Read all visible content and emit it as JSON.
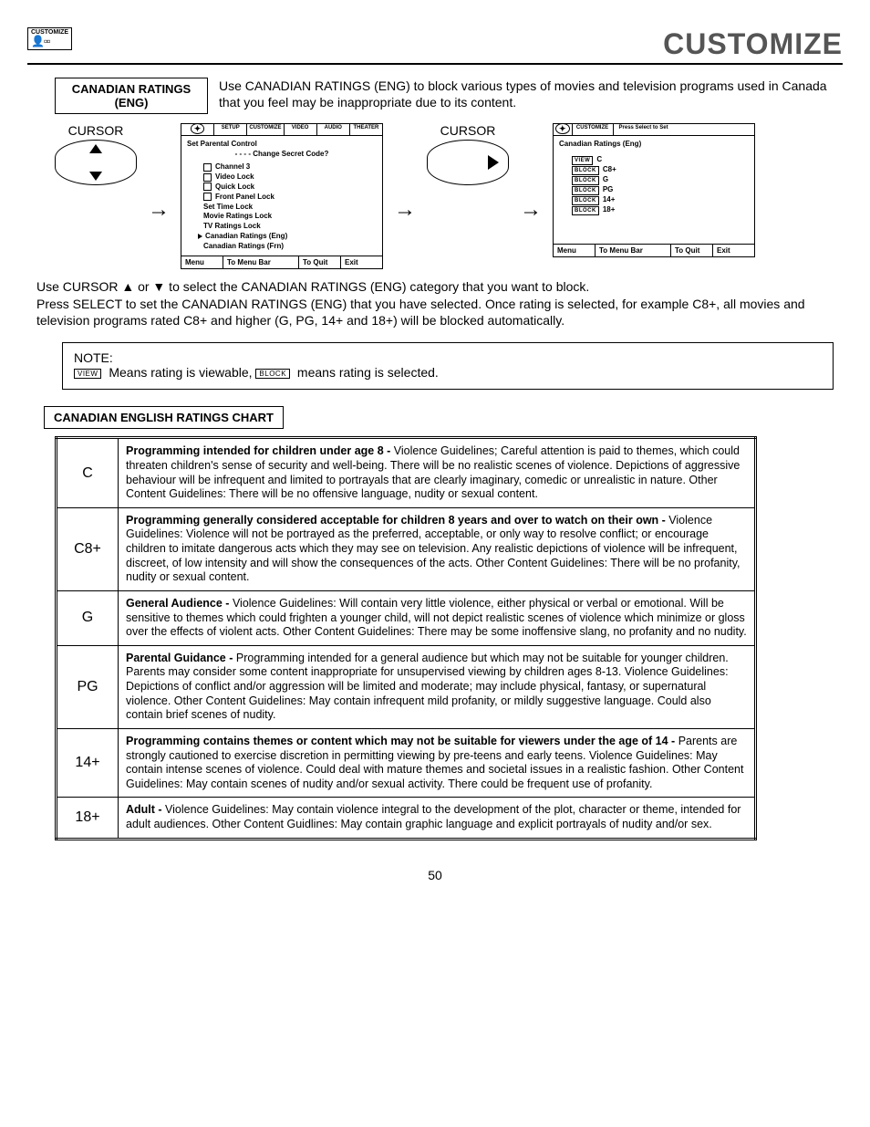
{
  "header": {
    "logo_label": "CUSTOMIZE",
    "title": "CUSTOMIZE"
  },
  "section_box": {
    "line1": "CANADIAN RATINGS",
    "line2": "(ENG)"
  },
  "intro": "Use CANADIAN RATINGS (ENG) to block various types of movies and television programs used in Canada that you feel may be inappropriate due to its content.",
  "cursor_label": "CURSOR",
  "osd1": {
    "tabs": [
      "SETUP",
      "CUSTOMIZE",
      "VIDEO",
      "AUDIO",
      "THEATER"
    ],
    "title": "Set Parental Control",
    "subtitle": "- - - - Change Secret Code?",
    "items_checkbox": [
      "Channel 3",
      "Video Lock",
      "Quick Lock",
      "Front Panel Lock"
    ],
    "items_plain": [
      "Set Time Lock",
      "Movie Ratings Lock",
      "TV Ratings Lock"
    ],
    "item_selected": "Canadian Ratings (Eng)",
    "item_last": "Canadian Ratings (Frn)",
    "footer": {
      "menu": "Menu",
      "bar": "To Menu Bar",
      "quit": "To Quit",
      "exit": "Exit"
    }
  },
  "osd2": {
    "tabs": [
      "",
      "CUSTOMIZE",
      "Press Select to Set"
    ],
    "title": "Canadian Ratings (Eng)",
    "rows": [
      {
        "tag": "VIEW",
        "label": "C"
      },
      {
        "tag": "BLOCK",
        "label": "C8+"
      },
      {
        "tag": "BLOCK",
        "label": "G"
      },
      {
        "tag": "BLOCK",
        "label": "PG"
      },
      {
        "tag": "BLOCK",
        "label": "14+"
      },
      {
        "tag": "BLOCK",
        "label": "18+"
      }
    ],
    "footer": {
      "menu": "Menu",
      "bar": "To Menu Bar",
      "quit": "To Quit",
      "exit": "Exit"
    }
  },
  "body1": "Use CURSOR ▲ or ▼ to select the CANADIAN RATINGS (ENG) category that you want to block.",
  "body2": "Press SELECT to set the CANADIAN RATINGS (ENG) that you have selected. Once rating is selected, for example C8+, all movies and television programs rated C8+ and higher (G, PG, 14+ and 18+) will be blocked automatically.",
  "note": {
    "title": "NOTE:",
    "view_tag": "VIEW",
    "part1": " Means rating is viewable, ",
    "block_tag": "BLOCK",
    "part2": " means rating is selected."
  },
  "chart_title": "CANADIAN ENGLISH RATINGS CHART",
  "chart": [
    {
      "code": "C",
      "strong": "Programming intended for children under age 8 - ",
      "rest": "Violence Guidelines; Careful attention is paid to themes, which could threaten children's sense of security and well-being.  There will be no realistic scenes of violence.  Depictions of aggressive behaviour will be infrequent and limited to portrayals that are clearly imaginary, comedic or unrealistic in nature.  Other Content Guidelines:  There will be no offensive language, nudity or sexual content."
    },
    {
      "code": "C8+",
      "strong": "Programming generally considered acceptable for children 8 years and over to watch on their own -  ",
      "rest": "Violence Guidelines: Violence will not be portrayed as the preferred, acceptable, or only way to resolve conflict; or encourage children to imitate dangerous acts which they may see on television.  Any realistic depictions of violence will be infrequent, discreet, of low intensity and will show the consequences of the acts. Other Content Guidelines: There will be no profanity, nudity or sexual content."
    },
    {
      "code": "G",
      "strong": "General Audience - ",
      "rest": "Violence Guidelines: Will contain very little violence, either physical or verbal or emotional.  Will be sensitive to themes which could frighten a younger child, will not depict realistic scenes of violence which minimize or gloss over the effects of violent acts.  Other Content Guidelines: There may be some inoffensive slang, no profanity and no nudity."
    },
    {
      "code": "PG",
      "strong": "Parental Guidance -  ",
      "rest": "Programming intended for a general audience but which may not be suitable for younger children.  Parents may consider some content inappropriate for unsupervised viewing by children ages 8-13. Violence Guidelines: Depictions of conflict and/or aggression will be limited and moderate; may include physical, fantasy, or supernatural violence.  Other Content Guidelines:  May contain infrequent mild profanity, or mildly suggestive language.  Could also contain brief scenes of nudity."
    },
    {
      "code": "14+",
      "strong": "Programming contains themes or content which may not be suitable for viewers under the age of 14 -  ",
      "rest": "Parents are strongly cautioned to exercise discretion in permitting viewing by pre-teens and early teens.  Violence Guidelines: May contain intense scenes of violence.  Could deal with mature themes and societal issues in a realistic fashion.  Other Content Guidelines: May contain scenes of nudity and/or sexual activity.  There could be frequent use of profanity."
    },
    {
      "code": "18+",
      "strong": "Adult - ",
      "rest": "Violence Guidelines: May contain violence integral to the development of the plot, character or theme, intended for adult audiences.  Other Content Guidlines: May contain graphic language and explicit portrayals of nudity and/or sex."
    }
  ],
  "page_number": "50"
}
